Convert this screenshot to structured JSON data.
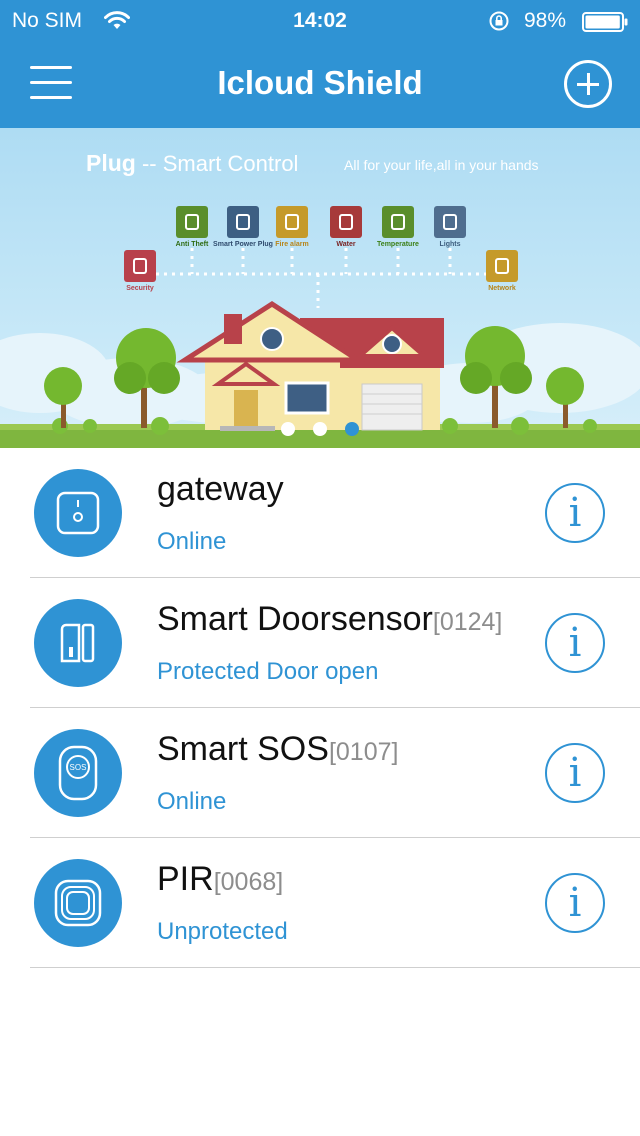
{
  "status_bar": {
    "carrier": "No SIM",
    "time": "14:02",
    "battery_percent": "98%",
    "battery_level": 0.98,
    "icons": [
      "wifi-icon",
      "orientation-lock-icon",
      "battery-icon"
    ]
  },
  "nav": {
    "title": "Icloud Shield",
    "menu_icon": "hamburger-menu-icon",
    "add_icon": "plus-circle-icon"
  },
  "banner": {
    "brand": "Plug",
    "heading": "-- Smart Control",
    "tagline": "All for your life,all in your hands",
    "features": [
      {
        "label": "Security",
        "icon": "padlock-icon",
        "color": "#b8404b",
        "label_color": "#b8404b"
      },
      {
        "label": "Anti Theft",
        "icon": "thief-icon",
        "color": "#5a8e2c",
        "label_color": "#2e6b12"
      },
      {
        "label": "Smart Power Plug",
        "icon": "power-plug-icon",
        "color": "#3d5f83",
        "label_color": "#2f4b6e"
      },
      {
        "label": "Fire alarm",
        "icon": "smoke-detector-icon",
        "color": "#c59a2a",
        "label_color": "#b7851a"
      },
      {
        "label": "Water",
        "icon": "water-drop-icon",
        "color": "#a73a3a",
        "label_color": "#7a2424"
      },
      {
        "label": "Temperature",
        "icon": "thermometer-icon",
        "color": "#5a8e2c",
        "label_color": "#3c7f17"
      },
      {
        "label": "Lights",
        "icon": "light-bulb-icon",
        "color": "#4f6d8e",
        "label_color": "#3d5d7e"
      },
      {
        "label": "Network",
        "icon": "router-icon",
        "color": "#c59a2a",
        "label_color": "#b7851a"
      }
    ],
    "pager": {
      "count": 3,
      "active_index": 2
    }
  },
  "devices": [
    {
      "name": "gateway",
      "code": "",
      "status": "Online",
      "icon": "gateway-icon"
    },
    {
      "name": "Smart Doorsensor",
      "code": "[0124]",
      "status": "Protected Door open",
      "icon": "door-sensor-icon"
    },
    {
      "name": "Smart SOS",
      "code": "[0107]",
      "status": "Online",
      "icon": "sos-button-icon"
    },
    {
      "name": "PIR",
      "code": "[0068]",
      "status": "Unprotected",
      "icon": "pir-sensor-icon"
    }
  ],
  "info_glyph": "i",
  "colors": {
    "accent": "#2f93d4",
    "divider": "#cfcfcf",
    "code_gray": "#8d8d8d"
  }
}
